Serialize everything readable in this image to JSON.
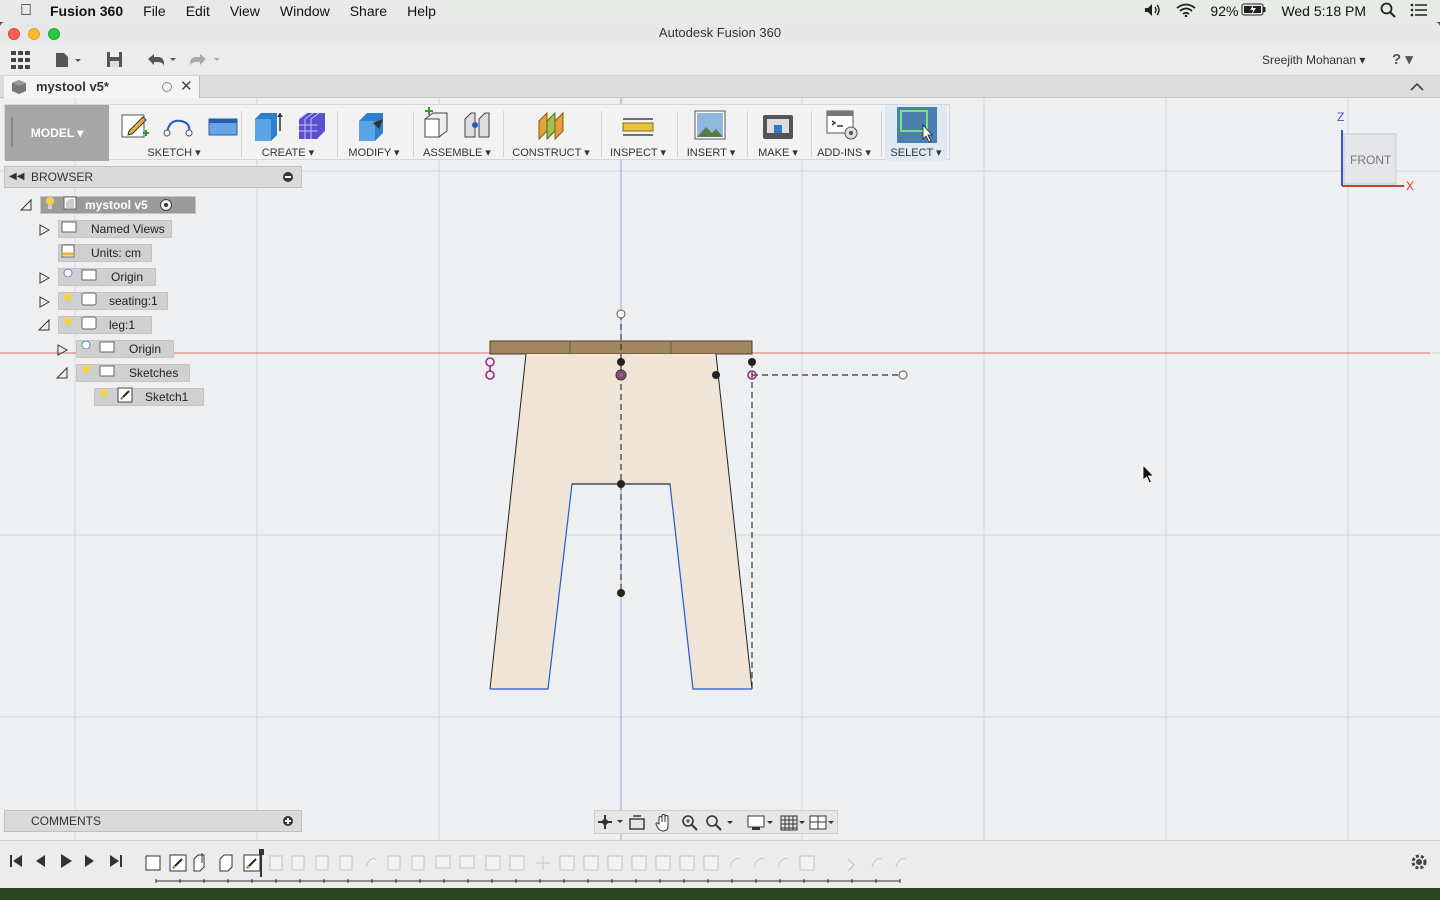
{
  "menubar": {
    "app_name": "Fusion 360",
    "items": [
      "File",
      "Edit",
      "View",
      "Window",
      "Share",
      "Help"
    ],
    "battery": "92%",
    "clock": "Wed 5:18 PM"
  },
  "window": {
    "title": "Autodesk Fusion 360"
  },
  "qat": {
    "user": "Sreejith Mohanan ▾",
    "help": "? ▾"
  },
  "doc_tab": {
    "name": "mystool v5*"
  },
  "ribbon": {
    "mode": "MODEL ▾",
    "groups": {
      "sketch": "SKETCH ▾",
      "create": "CREATE ▾",
      "modify": "MODIFY ▾",
      "assemble": "ASSEMBLE ▾",
      "construct": "CONSTRUCT ▾",
      "inspect": "INSPECT ▾",
      "insert": "INSERT ▾",
      "make": "MAKE ▾",
      "addins": "ADD-INS ▾",
      "select": "SELECT ▾"
    }
  },
  "browser": {
    "title": "BROWSER",
    "nodes": {
      "root": "mystool v5",
      "named_views": "Named Views",
      "units": "Units: cm",
      "origin": "Origin",
      "seating": "seating:1",
      "leg": "leg:1",
      "leg_origin": "Origin",
      "sketches": "Sketches",
      "sketch1": "Sketch1"
    }
  },
  "viewcube": {
    "face": "FRONT",
    "axis_z": "Z",
    "axis_x": "X"
  },
  "comments": {
    "title": "COMMENTS"
  },
  "colors": {
    "accent_select": "#4a7fb0",
    "sketch_line": "#1e5bd6",
    "profile_fill": "#efe4d6",
    "constraint": "#9b2a7a",
    "red_axis": "#e07070"
  }
}
